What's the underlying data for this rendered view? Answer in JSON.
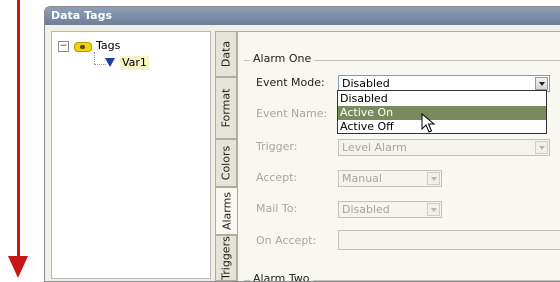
{
  "window": {
    "title": "Data Tags"
  },
  "tree": {
    "root_label": "Tags",
    "children": [
      {
        "label": "Var1"
      }
    ]
  },
  "tabs": [
    "Data",
    "Format",
    "Colors",
    "Alarms",
    "Triggers"
  ],
  "alarm_one": {
    "group_title": "Alarm One",
    "event_mode": {
      "label": "Event Mode:",
      "value": "Disabled"
    },
    "event_name": {
      "label": "Event Name:"
    },
    "trigger": {
      "label": "Trigger:",
      "value": "Level Alarm"
    },
    "accept": {
      "label": "Accept:",
      "value": "Manual"
    },
    "mail_to": {
      "label": "Mail To:",
      "value": "Disabled"
    },
    "on_accept": {
      "label": "On Accept:"
    }
  },
  "alarm_two": {
    "group_title": "Alarm Two"
  },
  "dropdown_options": [
    "Disabled",
    "Active On",
    "Active Off"
  ],
  "colors": {
    "accent_arrow": "#c61616",
    "selected_option": "#7a8a5c"
  }
}
